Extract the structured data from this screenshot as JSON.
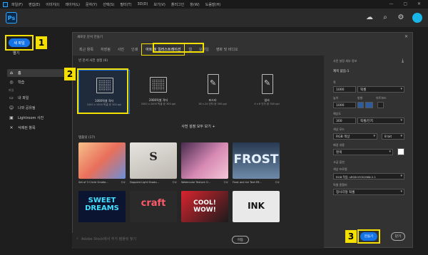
{
  "menubar": {
    "items": [
      "파일(F)",
      "편집(E)",
      "이미지(I)",
      "레이어(L)",
      "문자(Y)",
      "선택(S)",
      "필터(T)",
      "3D(D)",
      "보기(V)",
      "플러그인",
      "창(W)",
      "도움말(H)"
    ],
    "window_controls": "— ▢ ✕"
  },
  "appbar": {
    "logo": "Ps",
    "icons": [
      "cloud-icon",
      "search-icon",
      "gear-icon",
      "avatar"
    ]
  },
  "sidebar": {
    "new_button": "새 파일",
    "open_label": "열기",
    "items": [
      {
        "label": "홈",
        "icon": "⌂"
      },
      {
        "label": "학습",
        "icon": "◎"
      },
      {
        "label": "내 파일",
        "icon": "▭"
      },
      {
        "label": "나와 공유됨",
        "icon": "☺"
      },
      {
        "label": "Lightroom 사진",
        "icon": "▣"
      },
      {
        "label": "삭제된 항목",
        "icon": "✕"
      }
    ],
    "section_label": "파일"
  },
  "annotations": {
    "one": "1",
    "two": "2",
    "three": "3"
  },
  "dialog": {
    "title": "새로운 문서 만들기",
    "close": "✕",
    "tabs": [
      "최근 항목",
      "저장됨",
      "사진",
      "인쇄",
      "아트 및 일러스트레이션",
      "웹",
      "모바일",
      "영화 및 비디오"
    ],
    "blank_section": "빈 문서 사전 설정 (6)",
    "presets": [
      {
        "name": "1000픽셀 격자",
        "dim": "1000 x 1000 픽셀 @ 300 ppi"
      },
      {
        "name": "2000픽셀 격자",
        "dim": "2000 x 2000 픽셀 @ 300 ppi"
      },
      {
        "name": "포스터",
        "dim": "18 x 24 인치 @ 300 ppi"
      },
      {
        "name": "엽서",
        "dim": "4 x 6 인치 @ 300 ppi"
      }
    ],
    "see_all": "사전 설정 모두 보기 +",
    "templates_section": "템플릿 (17)",
    "templates": [
      {
        "name": "Set of 3 Circle Gradie...",
        "badge": "무료",
        "text": ""
      },
      {
        "name": "Dappled Light Shado...",
        "badge": "무료",
        "text": "S"
      },
      {
        "name": "Watercolor Texture O...",
        "badge": "무료",
        "text": ""
      },
      {
        "name": "Frost and Ice Text Eff...",
        "badge": "무료",
        "text": "FROST"
      },
      {
        "name": "",
        "badge": "",
        "text": "SWEET DREAMS"
      },
      {
        "name": "",
        "badge": "",
        "text": "craft"
      },
      {
        "name": "",
        "badge": "",
        "text": "COOL! WOW!"
      },
      {
        "name": "",
        "badge": "",
        "text": "INK"
      }
    ],
    "search_placeholder": "Adobe Stock에서 추가 템플릿 찾기",
    "search_go": "이동",
    "details": {
      "header": "사전 설정 세부 정보",
      "name": "제목 없음-1",
      "width_label": "폭",
      "width_value": "1000",
      "width_unit": "픽셀",
      "height_label": "높이",
      "orient_label": "방향",
      "artboard_label": "아트보드",
      "height_value": "1000",
      "res_label": "해상도",
      "res_value": "300",
      "res_unit": "픽셀/인치",
      "color_mode_label": "색상 모드",
      "color_mode": "RGB 색상",
      "bit_depth": "8 bit",
      "bg_label": "배경 내용",
      "bg_value": "흰색",
      "advanced_label": "고급 옵션",
      "profile_label": "색상 프로필",
      "profile_value": "RGB 작업: sRGB IEC61966-2.1",
      "pixel_ratio_label": "픽셀 종횡비",
      "pixel_ratio_value": "정사각형 픽셀"
    },
    "create_button": "만들기",
    "close_button": "닫기"
  },
  "colors": {
    "accent": "#1473e6",
    "highlight": "#f3df00"
  }
}
